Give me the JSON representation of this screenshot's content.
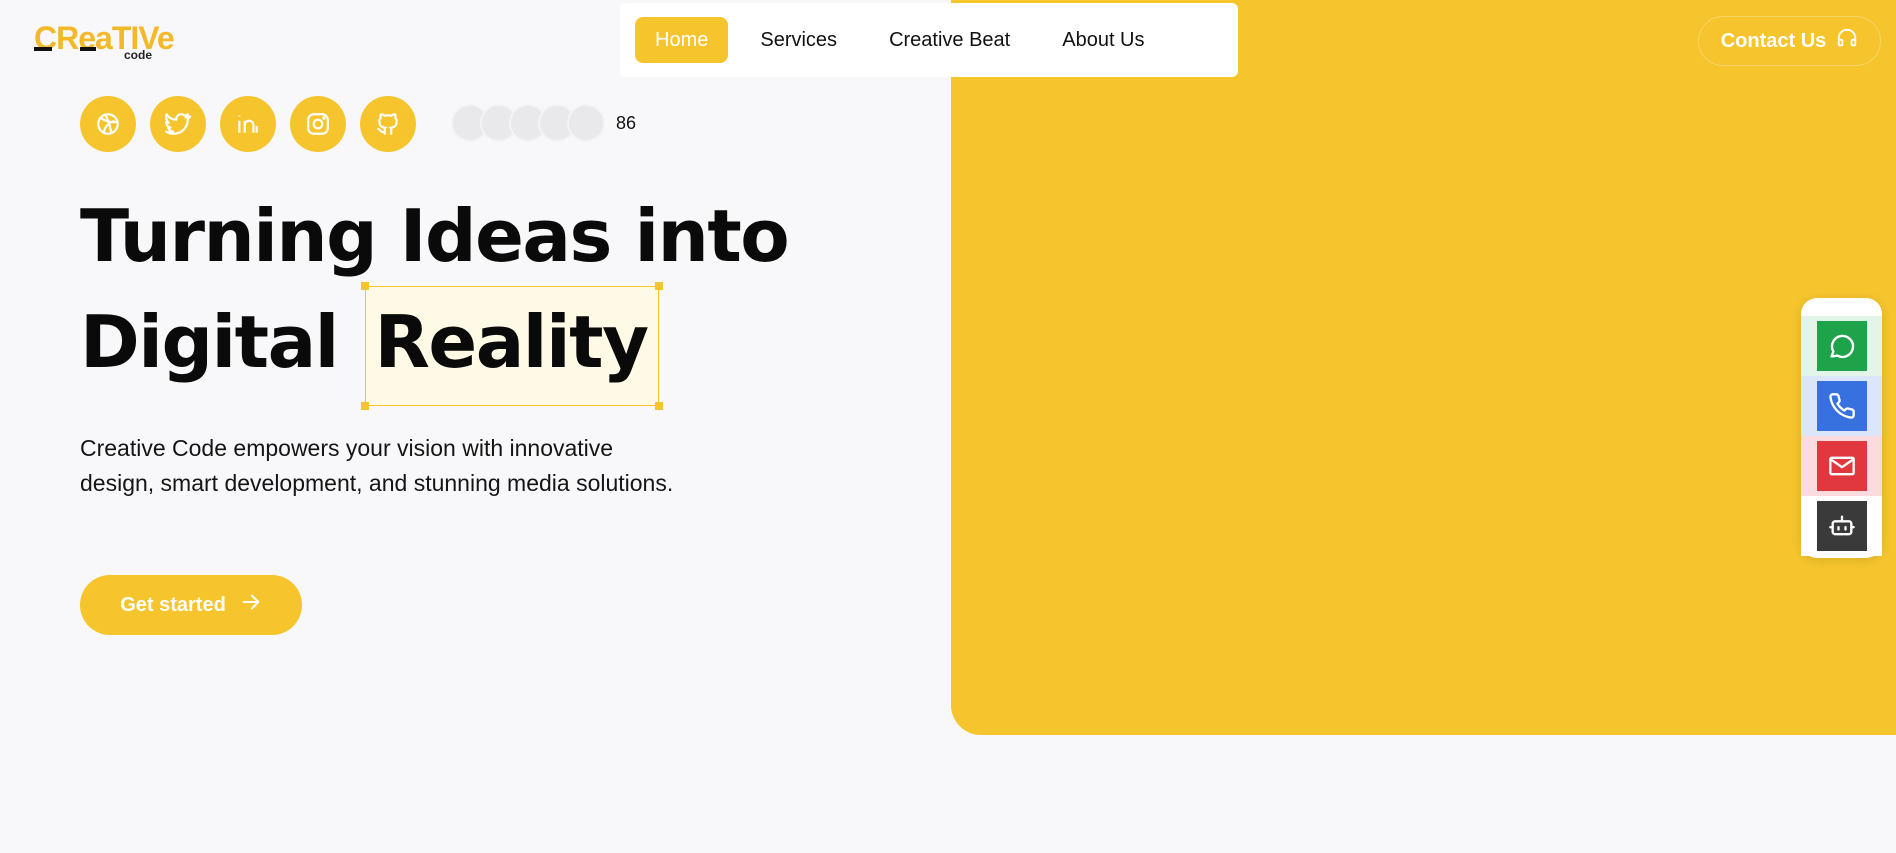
{
  "brand": {
    "logo_word": "CReaTIVe",
    "logo_sub": "code"
  },
  "nav": {
    "items": [
      {
        "label": "Home",
        "active": true
      },
      {
        "label": "Services",
        "active": false
      },
      {
        "label": "Creative Beat",
        "active": false
      },
      {
        "label": "About Us",
        "active": false
      }
    ]
  },
  "contact": {
    "label": "Contact Us",
    "icon": "headset-icon"
  },
  "socials": [
    {
      "name": "dribbble",
      "icon": "dribbble-icon"
    },
    {
      "name": "twitter",
      "icon": "twitter-icon"
    },
    {
      "name": "linkedin",
      "icon": "linkedin-icon"
    },
    {
      "name": "instagram",
      "icon": "instagram-icon"
    },
    {
      "name": "github",
      "icon": "github-icon"
    }
  ],
  "avatars": {
    "count_label": "86"
  },
  "hero": {
    "line1": "Turning Ideas into",
    "line2_prefix": "Digital",
    "highlight": "Reality",
    "description": "Creative Code empowers your vision with innovative design, smart development, and stunning media solutions.",
    "cta_label": "Get started"
  },
  "floating_actions": [
    {
      "name": "whatsapp",
      "icon": "whatsapp-icon",
      "color": "#1fa34a"
    },
    {
      "name": "phone",
      "icon": "phone-icon",
      "color": "#3771e0"
    },
    {
      "name": "email",
      "icon": "mail-icon",
      "color": "#e1383f"
    },
    {
      "name": "chatbot",
      "icon": "bot-icon",
      "color": "#3a3a3a"
    }
  ],
  "colors": {
    "accent": "#f6c42d",
    "background": "#f8f7f9"
  }
}
